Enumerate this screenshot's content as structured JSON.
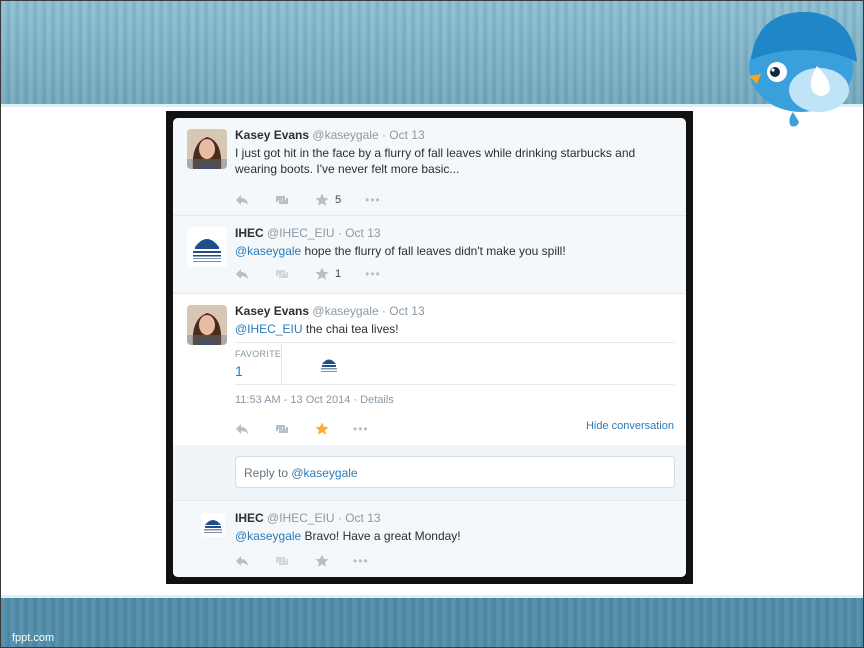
{
  "footer": {
    "brand": "fppt.com"
  },
  "tweets": [
    {
      "name": "Kasey Evans",
      "handle": "@kaseygale",
      "date": "· Oct 13",
      "text": "I just got hit in the face by a flurry of fall leaves while drinking starbucks and wearing boots. I've never felt more basic...",
      "favorite_count": "5"
    },
    {
      "name": "IHEC",
      "handle": "@IHEC_EIU",
      "date": "· Oct 13",
      "mention": "@kaseygale",
      "text": " hope the flurry of fall leaves didn't make you spill!",
      "favorite_count": "1"
    },
    {
      "name": "Kasey Evans",
      "handle": "@kaseygale",
      "date": "· Oct 13",
      "mention": "@IHEC_EIU",
      "text": " the chai tea lives!",
      "favorites_label": "FAVORITE",
      "favorites_count": "1",
      "timestamp": "11:53 AM - 13 Oct 2014 · Details",
      "hide_conversation": "Hide conversation"
    },
    {
      "name": "IHEC",
      "handle": "@IHEC_EIU",
      "date": "· Oct 13",
      "mention": "@kaseygale",
      "text": " Bravo! Have a great Monday!"
    }
  ],
  "reply": {
    "prefix": "Reply to ",
    "mention": "@kaseygale"
  },
  "icons": {
    "reply": "reply-arrow-icon",
    "retweet": "retweet-icon",
    "favorite": "star-icon",
    "more": "ellipsis-icon"
  },
  "colors": {
    "link_blue": "#2b7bb9",
    "favorited_star": "#ffac33",
    "icon_gray": "#b4bfc7"
  }
}
